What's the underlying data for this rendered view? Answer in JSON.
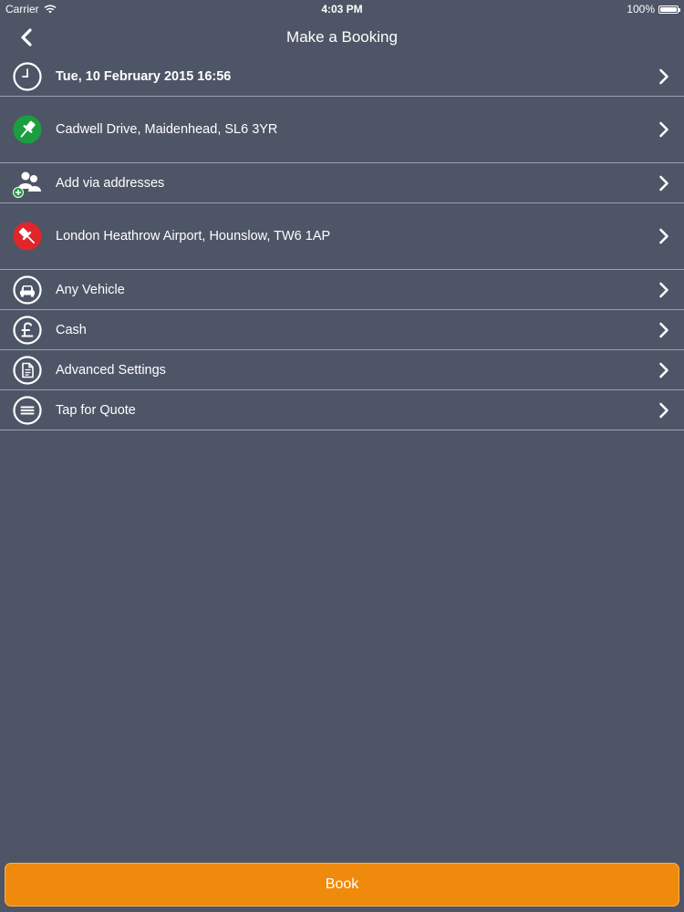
{
  "status_bar": {
    "carrier": "Carrier",
    "time": "4:03 PM",
    "battery": "100%",
    "battery_level": 1.0
  },
  "nav": {
    "title": "Make a Booking",
    "back_icon": "chevron-left-icon"
  },
  "rows": [
    {
      "label": "Tue, 10 February 2015 16:56",
      "icon": "clock-icon"
    },
    {
      "label": "Cadwell Drive, Maidenhead, SL6 3YR",
      "icon": "pickup-pin-icon",
      "icon_color": "#1a9e3f"
    },
    {
      "label": "Add via addresses",
      "icon": "add-people-icon",
      "icon_color": "#1a9e3f"
    },
    {
      "label": "London Heathrow Airport, Hounslow, TW6 1AP",
      "icon": "dropoff-pin-icon",
      "icon_color": "#e0262b"
    },
    {
      "label": "Any Vehicle",
      "icon": "car-icon"
    },
    {
      "label": "Cash",
      "icon": "pound-icon"
    },
    {
      "label": "Advanced Settings",
      "icon": "document-icon"
    },
    {
      "label": "Tap for Quote",
      "icon": "quote-icon"
    }
  ],
  "book_button": {
    "label": "Book",
    "color": "#f08a0c"
  },
  "colors": {
    "background": "#4e5566",
    "divider": "#9aa0ac"
  }
}
